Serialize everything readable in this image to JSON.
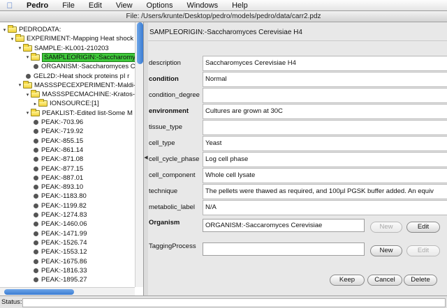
{
  "menubar": {
    "app": "Pedro",
    "items": [
      "File",
      "Edit",
      "View",
      "Options",
      "Windows",
      "Help"
    ]
  },
  "window": {
    "title": "File: /Users/krunte/Desktop/pedro/models/pedro/data/carr2.pdz"
  },
  "tree": {
    "nodes": [
      {
        "text": "PEDRODATA:",
        "kind": "folder",
        "twisty": "▾",
        "indent": 0
      },
      {
        "text": "EXPERIMENT:-Mapping Heat shock pro",
        "kind": "folder",
        "twisty": "▾",
        "indent": 1
      },
      {
        "text": "SAMPLE:-KL001-210203",
        "kind": "folder",
        "twisty": "▾",
        "indent": 2
      },
      {
        "text": "SAMPLEORIGIN:-Saccharomyces",
        "kind": "folder",
        "twisty": "▾",
        "indent": 3,
        "selected": true
      },
      {
        "text": "ORGANISM:-Saccharomyces Ce",
        "kind": "leaf",
        "indent": 4
      },
      {
        "text": "GEL2D:-Heat shock proteins pI r",
        "kind": "leaf",
        "indent": 3
      },
      {
        "text": "MASSSPECEXPERIMENT:-Maldi-T",
        "kind": "folder",
        "twisty": "▾",
        "indent": 2
      },
      {
        "text": "MASSSPECMACHINE:-Kratos-",
        "kind": "folder",
        "twisty": "▾",
        "indent": 3
      },
      {
        "text": "IONSOURCE:[1]",
        "kind": "folder",
        "twisty": "▸",
        "indent": 4
      },
      {
        "text": "PEAKLIST:-Edited list-Some M",
        "kind": "folder",
        "twisty": "▾",
        "indent": 3
      },
      {
        "text": "PEAK:-703.96",
        "kind": "leaf",
        "indent": 4
      },
      {
        "text": "PEAK:-719.92",
        "kind": "leaf",
        "indent": 4
      },
      {
        "text": "PEAK:-855.15",
        "kind": "leaf",
        "indent": 4
      },
      {
        "text": "PEAK:-861.14",
        "kind": "leaf",
        "indent": 4
      },
      {
        "text": "PEAK:-871.08",
        "kind": "leaf",
        "indent": 4
      },
      {
        "text": "PEAK:-877.15",
        "kind": "leaf",
        "indent": 4
      },
      {
        "text": "PEAK:-887.01",
        "kind": "leaf",
        "indent": 4
      },
      {
        "text": "PEAK:-893.10",
        "kind": "leaf",
        "indent": 4
      },
      {
        "text": "PEAK:-1183.80",
        "kind": "leaf",
        "indent": 4
      },
      {
        "text": "PEAK:-1199.82",
        "kind": "leaf",
        "indent": 4
      },
      {
        "text": "PEAK:-1274.83",
        "kind": "leaf",
        "indent": 4
      },
      {
        "text": "PEAK:-1460.06",
        "kind": "leaf",
        "indent": 4
      },
      {
        "text": "PEAK:-1471.99",
        "kind": "leaf",
        "indent": 4
      },
      {
        "text": "PEAK:-1526.74",
        "kind": "leaf",
        "indent": 4
      },
      {
        "text": "PEAK:-1553.12",
        "kind": "leaf",
        "indent": 4
      },
      {
        "text": "PEAK:-1675.86",
        "kind": "leaf",
        "indent": 4
      },
      {
        "text": "PEAK:-1816.33",
        "kind": "leaf",
        "indent": 4
      },
      {
        "text": "PEAK:-1895.27",
        "kind": "leaf",
        "indent": 4
      }
    ]
  },
  "detail": {
    "title": "SAMPLEORIGIN:-Saccharomyces Cerevisiae H4",
    "fields": [
      {
        "label": "description",
        "value": "Saccharomyces Cerevisiae H4",
        "bold": false
      },
      {
        "label": "condition",
        "value": "Normal",
        "bold": true
      },
      {
        "label": "condition_degree",
        "value": "",
        "bold": false
      },
      {
        "label": "environment",
        "value": "Cultures are grown at 30C",
        "bold": true
      },
      {
        "label": "tissue_type",
        "value": "",
        "bold": false
      },
      {
        "label": "cell_type",
        "value": "Yeast",
        "bold": false
      },
      {
        "label": "cell_cycle_phase",
        "value": "Log cell phase",
        "bold": false
      },
      {
        "label": "cell_component",
        "value": "Whole cell lysate",
        "bold": false
      },
      {
        "label": "technique",
        "value": "The pellets were thawed as required, and 100µl PGSK buffer added. An equiv",
        "bold": false
      },
      {
        "label": "metabolic_label",
        "value": "N/A",
        "bold": false
      }
    ],
    "organism": {
      "label": "Organism",
      "value": "ORGANISM:-Saccaromyces Cerevisiae",
      "new_label": "New",
      "edit_label": "Edit"
    },
    "tagging": {
      "label": "TaggingProcess",
      "value": "",
      "new_label": "New",
      "edit_label": "Edit"
    },
    "actions": {
      "keep": "Keep",
      "cancel": "Cancel",
      "delete": "Delete"
    }
  },
  "status": {
    "label": "Status:",
    "text": ""
  }
}
